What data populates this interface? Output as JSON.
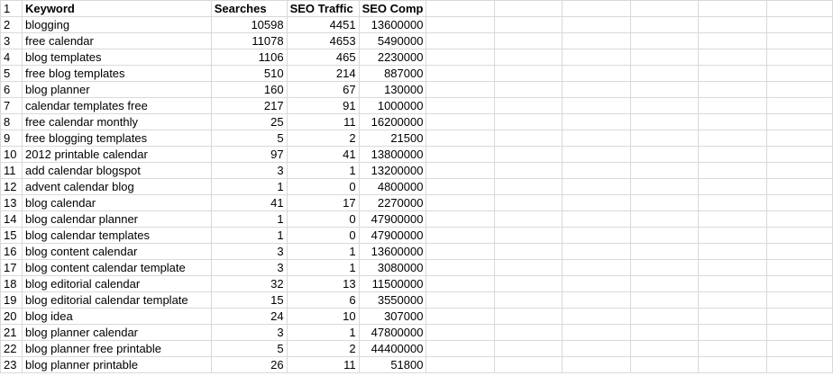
{
  "headers": [
    "Keyword",
    "Searches",
    "SEO Traffic",
    "SEO Comp"
  ],
  "rows": [
    {
      "n": "2",
      "keyword": "blogging",
      "searches": "10598",
      "traffic": "4451",
      "comp": "13600000"
    },
    {
      "n": "3",
      "keyword": "free calendar",
      "searches": "11078",
      "traffic": "4653",
      "comp": "5490000"
    },
    {
      "n": "4",
      "keyword": "blog templates",
      "searches": "1106",
      "traffic": "465",
      "comp": "2230000"
    },
    {
      "n": "5",
      "keyword": "free blog templates",
      "searches": "510",
      "traffic": "214",
      "comp": "887000"
    },
    {
      "n": "6",
      "keyword": "blog planner",
      "searches": "160",
      "traffic": "67",
      "comp": "130000"
    },
    {
      "n": "7",
      "keyword": "calendar templates free",
      "searches": "217",
      "traffic": "91",
      "comp": "1000000"
    },
    {
      "n": "8",
      "keyword": "free calendar monthly",
      "searches": "25",
      "traffic": "11",
      "comp": "16200000"
    },
    {
      "n": "9",
      "keyword": "free blogging templates",
      "searches": "5",
      "traffic": "2",
      "comp": "21500"
    },
    {
      "n": "10",
      "keyword": "2012 printable calendar",
      "searches": "97",
      "traffic": "41",
      "comp": "13800000"
    },
    {
      "n": "11",
      "keyword": "add calendar blogspot",
      "searches": "3",
      "traffic": "1",
      "comp": "13200000"
    },
    {
      "n": "12",
      "keyword": "advent calendar blog",
      "searches": "1",
      "traffic": "0",
      "comp": "4800000"
    },
    {
      "n": "13",
      "keyword": "blog calendar",
      "searches": "41",
      "traffic": "17",
      "comp": "2270000"
    },
    {
      "n": "14",
      "keyword": "blog calendar planner",
      "searches": "1",
      "traffic": "0",
      "comp": "47900000"
    },
    {
      "n": "15",
      "keyword": "blog calendar templates",
      "searches": "1",
      "traffic": "0",
      "comp": "47900000"
    },
    {
      "n": "16",
      "keyword": "blog content calendar",
      "searches": "3",
      "traffic": "1",
      "comp": "13600000"
    },
    {
      "n": "17",
      "keyword": "blog content calendar template",
      "searches": "3",
      "traffic": "1",
      "comp": "3080000"
    },
    {
      "n": "18",
      "keyword": "blog editorial calendar",
      "searches": "32",
      "traffic": "13",
      "comp": "11500000"
    },
    {
      "n": "19",
      "keyword": "blog editorial calendar template",
      "searches": "15",
      "traffic": "6",
      "comp": "3550000"
    },
    {
      "n": "20",
      "keyword": "blog idea",
      "searches": "24",
      "traffic": "10",
      "comp": "307000"
    },
    {
      "n": "21",
      "keyword": "blog planner calendar",
      "searches": "3",
      "traffic": "1",
      "comp": "47800000"
    },
    {
      "n": "22",
      "keyword": "blog planner free printable",
      "searches": "5",
      "traffic": "2",
      "comp": "44400000"
    },
    {
      "n": "23",
      "keyword": "blog planner printable",
      "searches": "26",
      "traffic": "11",
      "comp": "51800"
    }
  ]
}
